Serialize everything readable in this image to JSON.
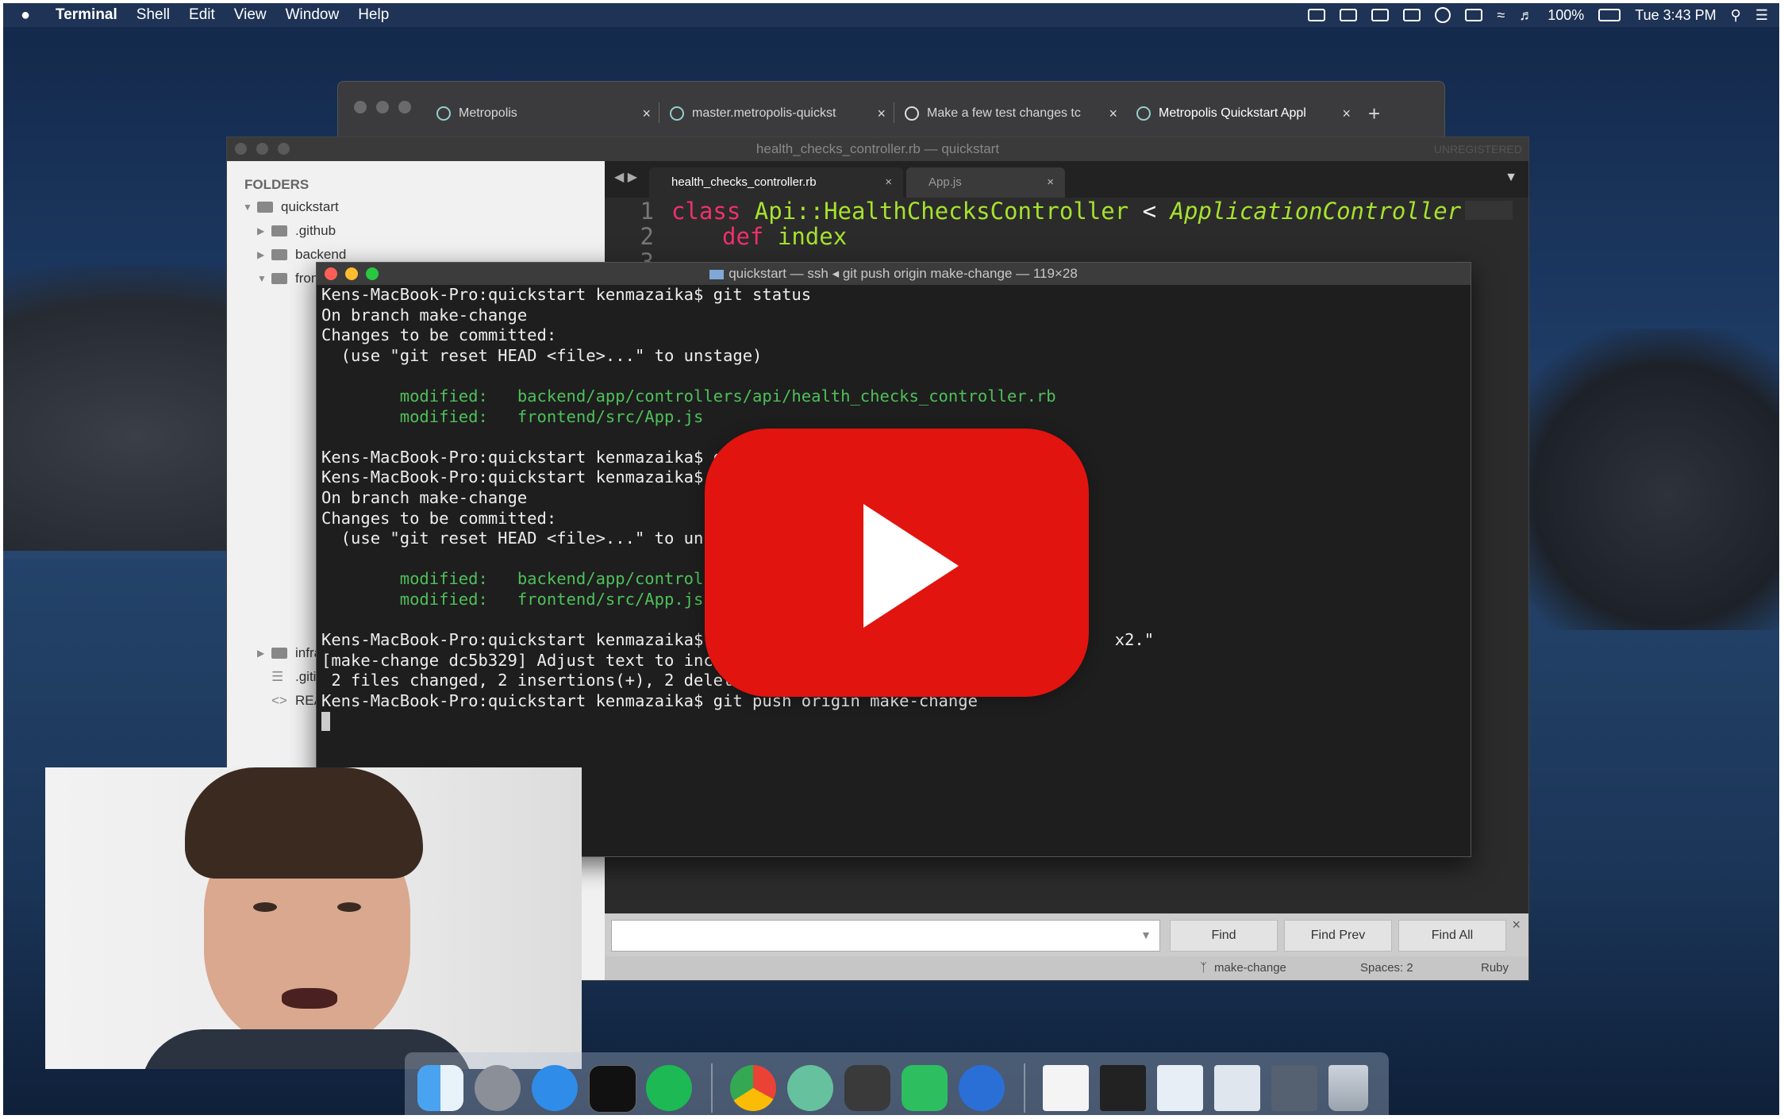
{
  "menubar": {
    "app_name": "Terminal",
    "items": [
      "Shell",
      "Edit",
      "View",
      "Window",
      "Help"
    ],
    "battery": "100%",
    "clock": "Tue 3:43 PM"
  },
  "browser": {
    "tabs": [
      {
        "label": "Metropolis"
      },
      {
        "label": "master.metropolis-quickst"
      },
      {
        "label": "Make a few test changes tc"
      },
      {
        "label": "Metropolis Quickstart Appl"
      }
    ],
    "new_tab": "+"
  },
  "sublime": {
    "title": "health_checks_controller.rb — quickstart",
    "unregistered": "UNREGISTERED",
    "folders_header": "FOLDERS",
    "tree": [
      {
        "label": "quickstart"
      },
      {
        "label": ".github"
      },
      {
        "label": "backend"
      },
      {
        "label": "fron"
      },
      {
        "label": "infra"
      },
      {
        "label": ".giti"
      },
      {
        "label": "REA"
      }
    ],
    "tabs": [
      {
        "label": "health_checks_controller.rb"
      },
      {
        "label": "App.js"
      }
    ],
    "code": {
      "line1_no": "1",
      "line2_no": "2",
      "line3_no": "3",
      "l1_kw": "class",
      "l1_name": "Api::HealthChecksController",
      "l1_op": " < ",
      "l1_super": "ApplicationController",
      "l2_kw": "def",
      "l2_name": "index"
    },
    "find": {
      "find": "Find",
      "find_prev": "Find Prev",
      "find_all": "Find All"
    },
    "status": {
      "branch": "make-change",
      "spaces": "Spaces: 2",
      "syntax": "Ruby"
    }
  },
  "terminal": {
    "title": "quickstart — ssh ◂ git push origin make-change — 119×28",
    "lines": [
      {
        "text": "Kens-MacBook-Pro:quickstart kenmazaika$ git status",
        "color": "white"
      },
      {
        "text": "On branch make-change",
        "color": "white"
      },
      {
        "text": "Changes to be committed:",
        "color": "white"
      },
      {
        "text": "  (use \"git reset HEAD <file>...\" to unstage)",
        "color": "white"
      },
      {
        "text": "",
        "color": "white"
      },
      {
        "text": "        modified:   backend/app/controllers/api/health_checks_controller.rb",
        "color": "green"
      },
      {
        "text": "        modified:   frontend/src/App.js",
        "color": "green"
      },
      {
        "text": "",
        "color": "white"
      },
      {
        "text": "Kens-MacBook-Pro:quickstart kenmazaika$ g",
        "color": "white"
      },
      {
        "text": "Kens-MacBook-Pro:quickstart kenmazaika$ ",
        "color": "white"
      },
      {
        "text": "On branch make-change",
        "color": "white"
      },
      {
        "text": "Changes to be committed:",
        "color": "white"
      },
      {
        "text": "  (use \"git reset HEAD <file>...\" to uns",
        "color": "white"
      },
      {
        "text": "",
        "color": "white"
      },
      {
        "text": "        modified:   backend/app/controll",
        "color": "green"
      },
      {
        "text": "        modified:   frontend/src/App.js",
        "color": "green"
      },
      {
        "text": "",
        "color": "white"
      },
      {
        "text": "Kens-MacBook-Pro:quickstart kenmazaika$                                          x2.\"",
        "color": "white"
      },
      {
        "text": "[make-change dc5b329] Adjust text to inci",
        "color": "white"
      },
      {
        "text": " 2 files changed, 2 insertions(+), 2 delet",
        "color": "white"
      },
      {
        "text": "Kens-MacBook-Pro:quickstart kenmazaika$ git push origin make-change",
        "color": "white"
      }
    ]
  },
  "dock": {
    "apps": [
      "finder-icon",
      "launchpad-icon",
      "safari-icon",
      "terminal-icon",
      "spotify-icon",
      "chrome-icon",
      "atom-icon",
      "sublime-icon",
      "evernote-icon",
      "screenflick-icon",
      "document-icon",
      "terminal-window-icon",
      "chrome-window-icon",
      "browser-window-icon",
      "screen-window-icon",
      "trash-icon"
    ]
  },
  "colors": {
    "youtube_red": "#e1140f",
    "terminal_green": "#4ec05a",
    "keyword_pink": "#f0306c",
    "class_green": "#a6e22e"
  }
}
